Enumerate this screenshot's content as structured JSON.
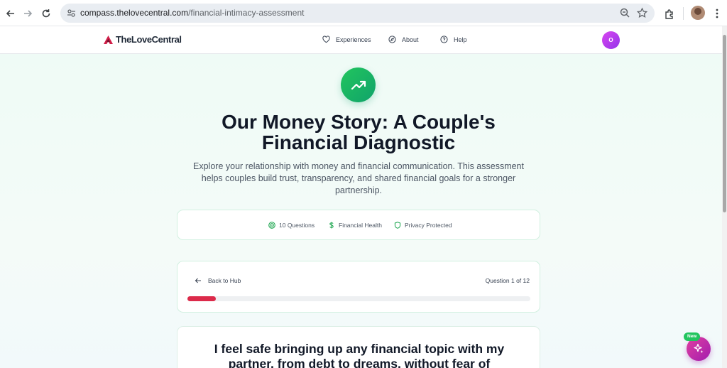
{
  "browser": {
    "url_host": "compass.thelovecentral.com",
    "url_path": "/financial-intimacy-assessment"
  },
  "header": {
    "brand": "TheLoveCentral",
    "nav": [
      {
        "label": "Experiences",
        "icon": "heart-icon"
      },
      {
        "label": "About",
        "icon": "compass-icon"
      },
      {
        "label": "Help",
        "icon": "help-circle-icon"
      }
    ],
    "avatar_initial": "O"
  },
  "hero": {
    "icon": "trending-up-icon",
    "title_line1": "Our Money Story: A Couple's",
    "title_line2": "Financial Diagnostic",
    "subtitle": "Explore your relationship with money and financial communication. This assessment helps couples build trust, transparency, and shared financial goals for a stronger partnership."
  },
  "features": [
    {
      "label": "10 Questions",
      "icon": "target-icon"
    },
    {
      "label": "Financial Health",
      "icon": "dollar-icon"
    },
    {
      "label": "Privacy Protected",
      "icon": "shield-icon"
    }
  ],
  "progress": {
    "back_label": "Back to Hub",
    "question_label": "Question 1 of 12",
    "fraction": 0.083
  },
  "question": {
    "text": "I feel safe bringing up any financial topic with my partner, from debt to dreams, without fear of"
  },
  "fab": {
    "badge": "New",
    "icon": "sparkles-icon"
  },
  "colors": {
    "accent_green": "#10a36a",
    "progress_red": "#dc2a4a",
    "avatar_purple": "#c026d3"
  }
}
